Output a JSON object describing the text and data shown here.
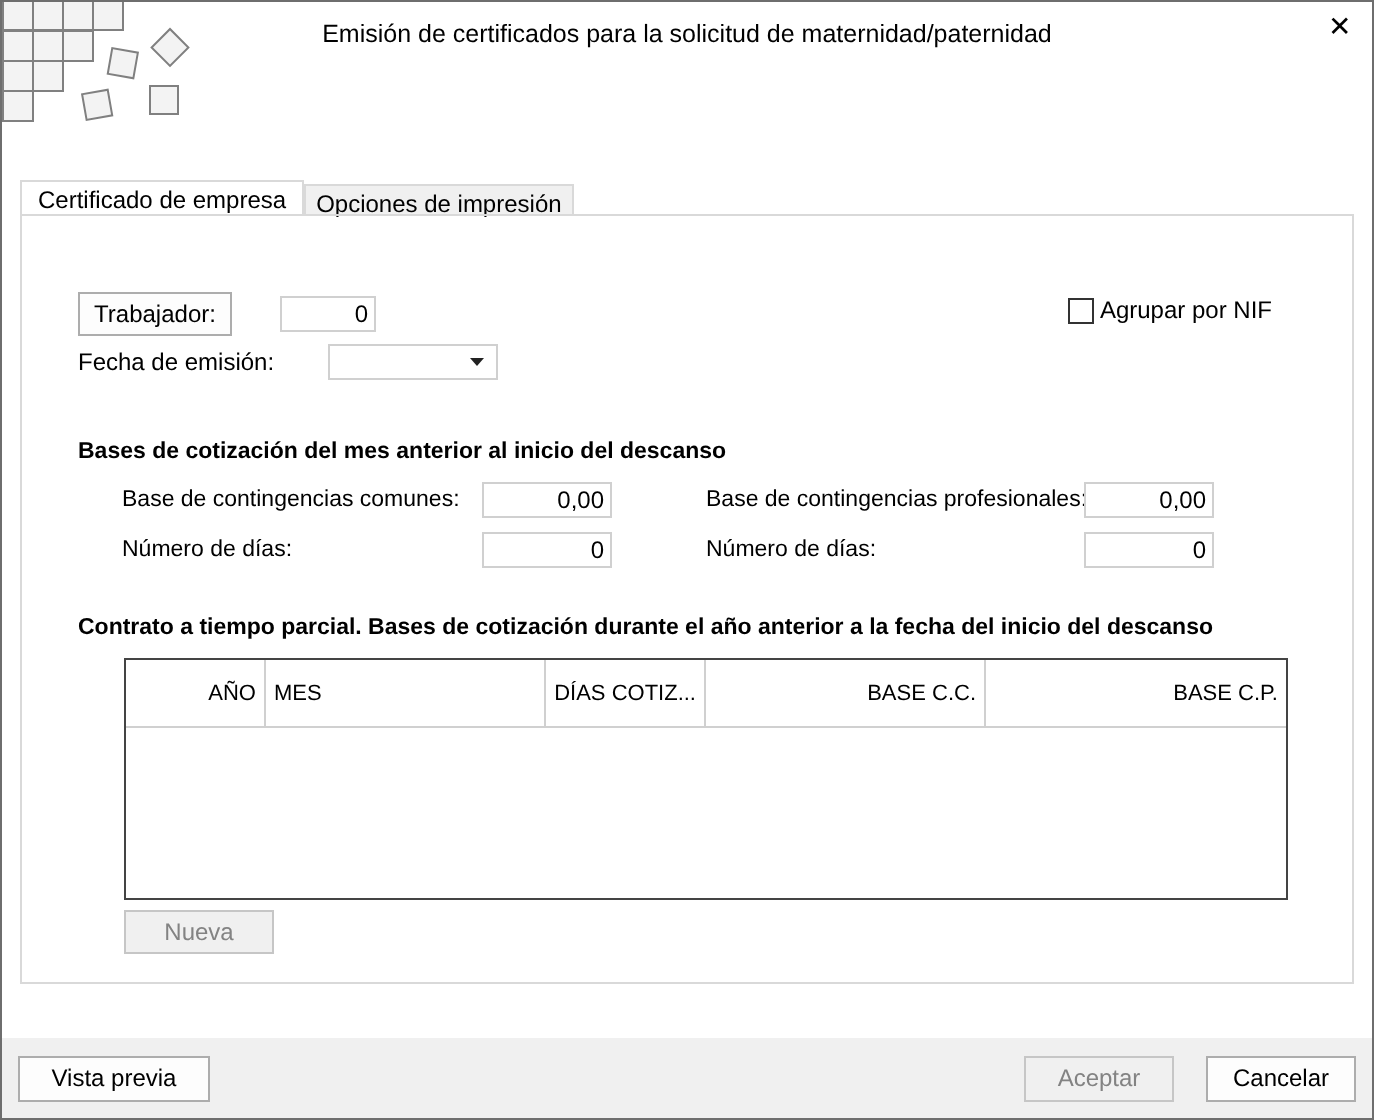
{
  "window": {
    "title": "Emisión de certificados para la solicitud de maternidad/paternidad",
    "close": "✕"
  },
  "tabs": [
    {
      "label": "Certificado de empresa",
      "selected": true
    },
    {
      "label": "Opciones de impresión",
      "selected": false
    }
  ],
  "worker": {
    "button": "Trabajador:",
    "value": "0"
  },
  "issue_date": {
    "label": "Fecha de emisión:"
  },
  "group_by_nif": {
    "label": "Agrupar por NIF",
    "checked": false
  },
  "previous_month": {
    "heading": "Bases de cotización del mes anterior al inicio del descanso",
    "fields": [
      {
        "label": "Base de contingencias comunes:",
        "value": "0,00"
      },
      {
        "label": "Base de contingencias profesionales:",
        "value": "0,00"
      },
      {
        "label": "Número de días:",
        "value": "0"
      },
      {
        "label": "Número de días:",
        "value": "0"
      }
    ]
  },
  "part_time": {
    "heading": "Contrato a tiempo parcial. Bases de cotización durante el año anterior a la fecha del inicio del descanso",
    "table": {
      "columns": [
        {
          "label": "AÑO"
        },
        {
          "label": "MES"
        },
        {
          "label": "DÍAS COTIZ..."
        },
        {
          "label": "BASE C.C."
        },
        {
          "label": "BASE C.P."
        }
      ]
    },
    "new_button": {
      "label": "Nueva",
      "disabled": true
    }
  },
  "footer": {
    "buttons": [
      {
        "label": "Vista previa",
        "disabled": false
      },
      {
        "label": "Aceptar",
        "disabled": true
      },
      {
        "label": "Cancelar",
        "disabled": false
      }
    ]
  }
}
